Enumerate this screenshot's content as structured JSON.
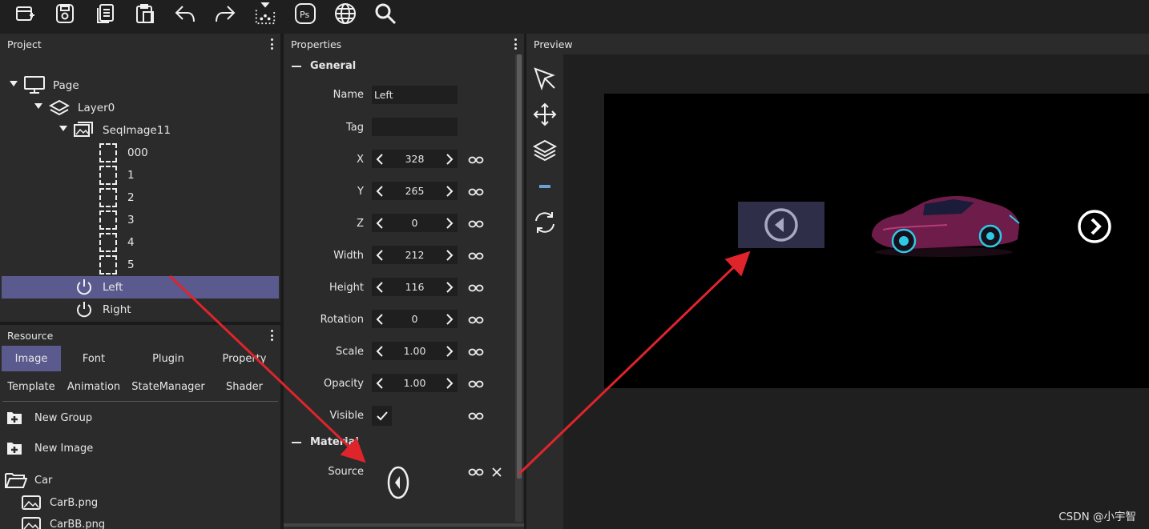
{
  "toolbar": {
    "icons": [
      "new-page-icon",
      "save-icon",
      "copy-icon",
      "paste-icon",
      "undo-icon",
      "redo-icon",
      "export-icon",
      "photoshop-icon",
      "web-icon",
      "search-icon"
    ],
    "ps_label": "Ps"
  },
  "project": {
    "title": "Project",
    "tree": [
      {
        "label": "Page",
        "icon": "monitor-icon"
      },
      {
        "label": "Layer0",
        "icon": "layers-icon"
      },
      {
        "label": "SeqImage11",
        "icon": "images-icon"
      },
      {
        "label": "000",
        "icon": "frame-icon"
      },
      {
        "label": "1",
        "icon": "frame-icon"
      },
      {
        "label": "2",
        "icon": "frame-icon"
      },
      {
        "label": "3",
        "icon": "frame-icon"
      },
      {
        "label": "4",
        "icon": "frame-icon"
      },
      {
        "label": "5",
        "icon": "frame-icon"
      },
      {
        "label": "Left",
        "icon": "power-icon",
        "selected": true
      },
      {
        "label": "Right",
        "icon": "power-icon"
      }
    ]
  },
  "resource": {
    "title": "Resource",
    "tabs_row1": [
      "Image",
      "Font",
      "Plugin",
      "Property"
    ],
    "tabs_row2": [
      "Template",
      "Animation",
      "StateManager",
      "Shader"
    ],
    "active_tab": "Image",
    "items": {
      "new_group": "New Group",
      "new_image": "New Image",
      "folder": "Car",
      "file1": "CarB.png",
      "file2": "CarBB.png"
    }
  },
  "properties": {
    "title": "Properties",
    "general": "General",
    "material": "Material",
    "name_label": "Name",
    "name_value": "Left",
    "tag_label": "Tag",
    "tag_value": "",
    "x_label": "X",
    "x_value": "328",
    "y_label": "Y",
    "y_value": "265",
    "z_label": "Z",
    "z_value": "0",
    "width_label": "Width",
    "width_value": "212",
    "height_label": "Height",
    "height_value": "116",
    "rotation_label": "Rotation",
    "rotation_value": "0",
    "scale_label": "Scale",
    "scale_value": "1.00",
    "opacity_label": "Opacity",
    "opacity_value": "1.00",
    "visible_label": "Visible",
    "visible_checked": true,
    "source_label": "Source"
  },
  "preview": {
    "title": "Preview",
    "side_tools": [
      "select-icon",
      "move-icon",
      "layers-icon",
      "grid-icon",
      "refresh-icon"
    ]
  },
  "watermark": "CSDN @小宇智",
  "colors": {
    "accent": "#5a5a8e",
    "background": "#1f1f1f",
    "panel": "#2b2b2b",
    "annotation_arrow": "#e0242b",
    "left_button_bg": "#2e2e48"
  }
}
